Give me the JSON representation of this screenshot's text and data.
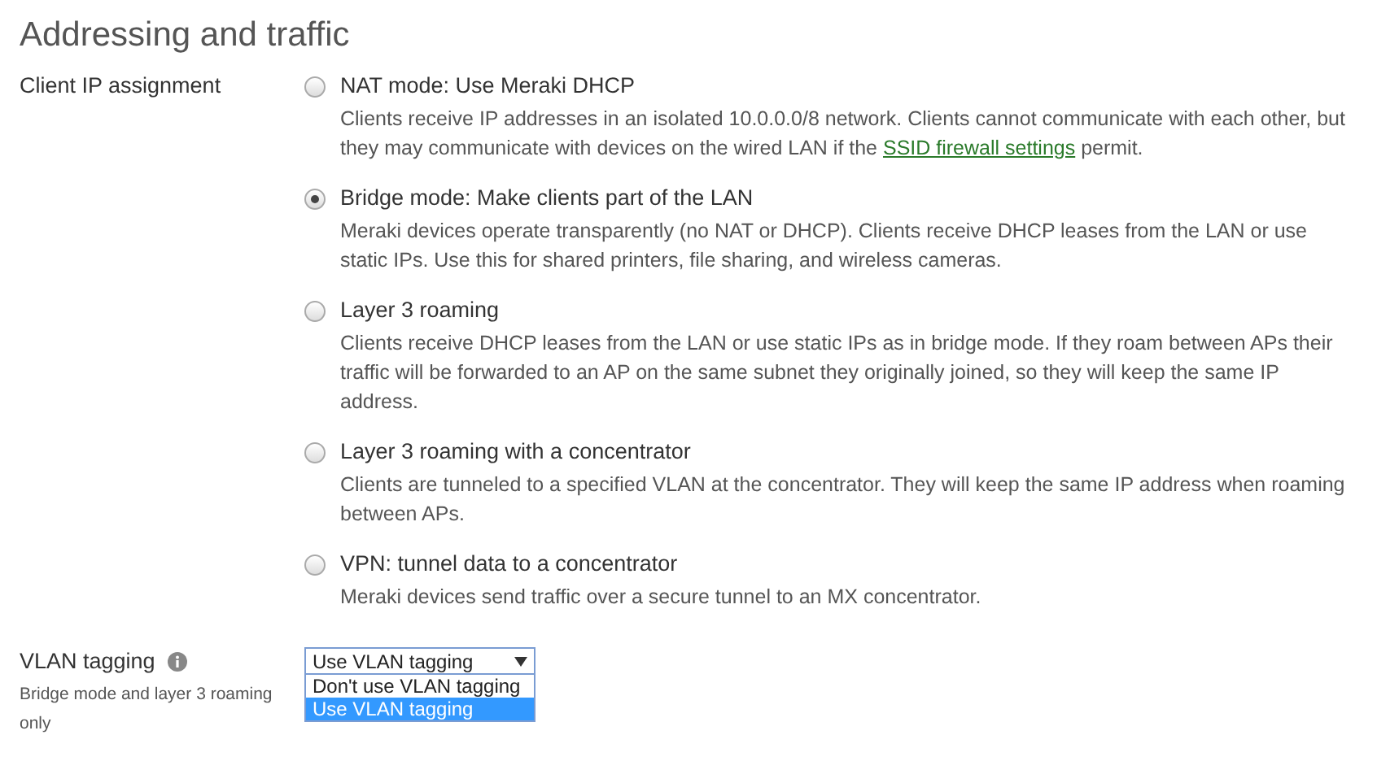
{
  "section": {
    "title": "Addressing and traffic"
  },
  "client_ip": {
    "label": "Client IP assignment",
    "options": [
      {
        "title": "NAT mode: Use Meraki DHCP",
        "selected": false,
        "description": "Clients receive IP addresses in an isolated 10.0.0.0/8 network. Clients cannot communicate with each other, but they may communicate with devices on the wired LAN if the",
        "link": "SSID firewall settings",
        "description_end": "permit."
      },
      {
        "title": "Bridge mode: Make clients part of the LAN",
        "selected": true,
        "description": "Meraki devices operate transparently (no NAT or DHCP). Clients receive DHCP leases from the LAN or use static IPs. Use this for shared printers, file sharing, and wireless cameras."
      },
      {
        "title": "Layer 3 roaming",
        "selected": false,
        "description": "Clients receive DHCP leases from the LAN or use static IPs as in bridge mode. If they roam between APs their traffic will be forwarded to an AP on the same subnet they originally joined, so they will keep the same IP address."
      },
      {
        "title": "Layer 3 roaming with a concentrator",
        "selected": false,
        "description": "Clients are tunneled to a specified VLAN at the concentrator. They will keep the same IP address when roaming between APs."
      },
      {
        "title": "VPN: tunnel data to a concentrator",
        "selected": false,
        "description": "Meraki devices send traffic over a secure tunnel to an MX concentrator."
      }
    ]
  },
  "vlan": {
    "label": "VLAN tagging",
    "hint": "Bridge mode and layer 3 roaming only",
    "dropdown": {
      "value": "Use VLAN tagging",
      "expanded": true,
      "options": [
        {
          "label": "Don't use VLAN tagging",
          "selected": false
        },
        {
          "label": "Use VLAN tagging",
          "selected": true
        }
      ]
    }
  }
}
